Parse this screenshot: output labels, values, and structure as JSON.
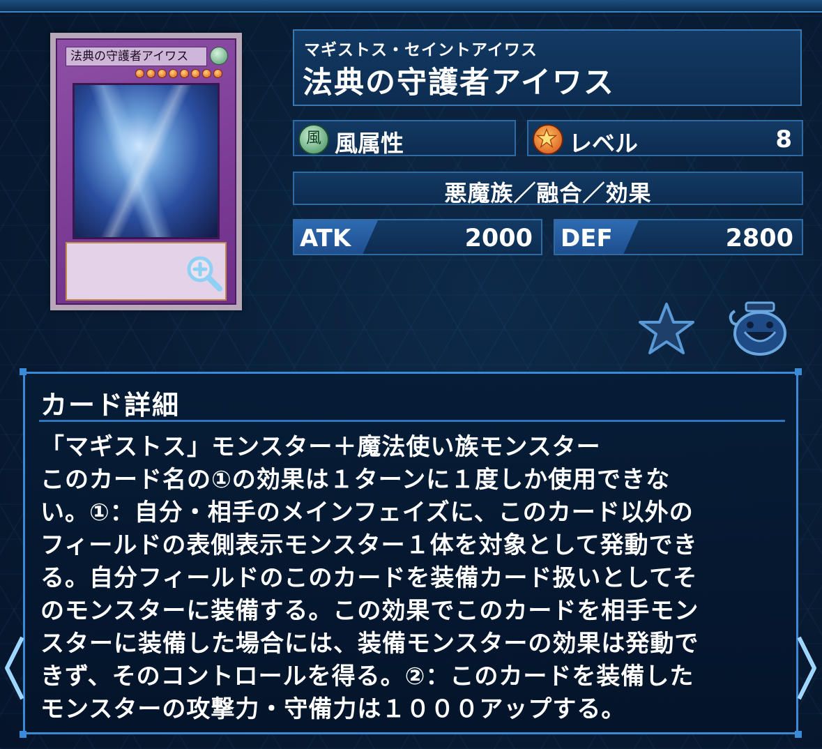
{
  "card": {
    "ruby": "マギストス・セイントアイワス",
    "name": "法典の守護者アイワス",
    "image_name": "法典の守護者アイワス",
    "attribute": "風属性",
    "attribute_glyph": "風",
    "level_label": "レベル",
    "level_value": "8",
    "type_line": "悪魔族／融合／効果",
    "atk_label": "ATK",
    "atk_value": "2000",
    "def_label": "DEF",
    "def_value": "2800"
  },
  "detail": {
    "title": "カード詳細",
    "text": "「マギストス」モンスター＋魔法使い族モンスター\nこのカード名の①の効果は１ターンに１度しか使用できな\nい。①：自分・相手のメインフェイズに、このカード以外の\nフィールドの表側表示モンスター１体を対象として発動でき\nる。自分フィールドのこのカードを装備カード扱いとしてそ\nのモンスターに装備する。この効果でこのカードを相手モン\nスターに装備した場合には、装備モンスターの効果は発動で\nきず、そのコントロールを得る。②：このカードを装備した\nモンスターの攻撃力・守備力は１０００アップする。"
  },
  "icons": {
    "zoom": "zoom-in-icon",
    "favorite": "star-icon",
    "pot": "pot-of-greed-icon",
    "prev": "chevron-left-icon",
    "next": "chevron-right-icon"
  },
  "colors": {
    "accent": "#3a8ad8",
    "panel": "#0d2c50",
    "card_frame": "#7b3b96"
  }
}
